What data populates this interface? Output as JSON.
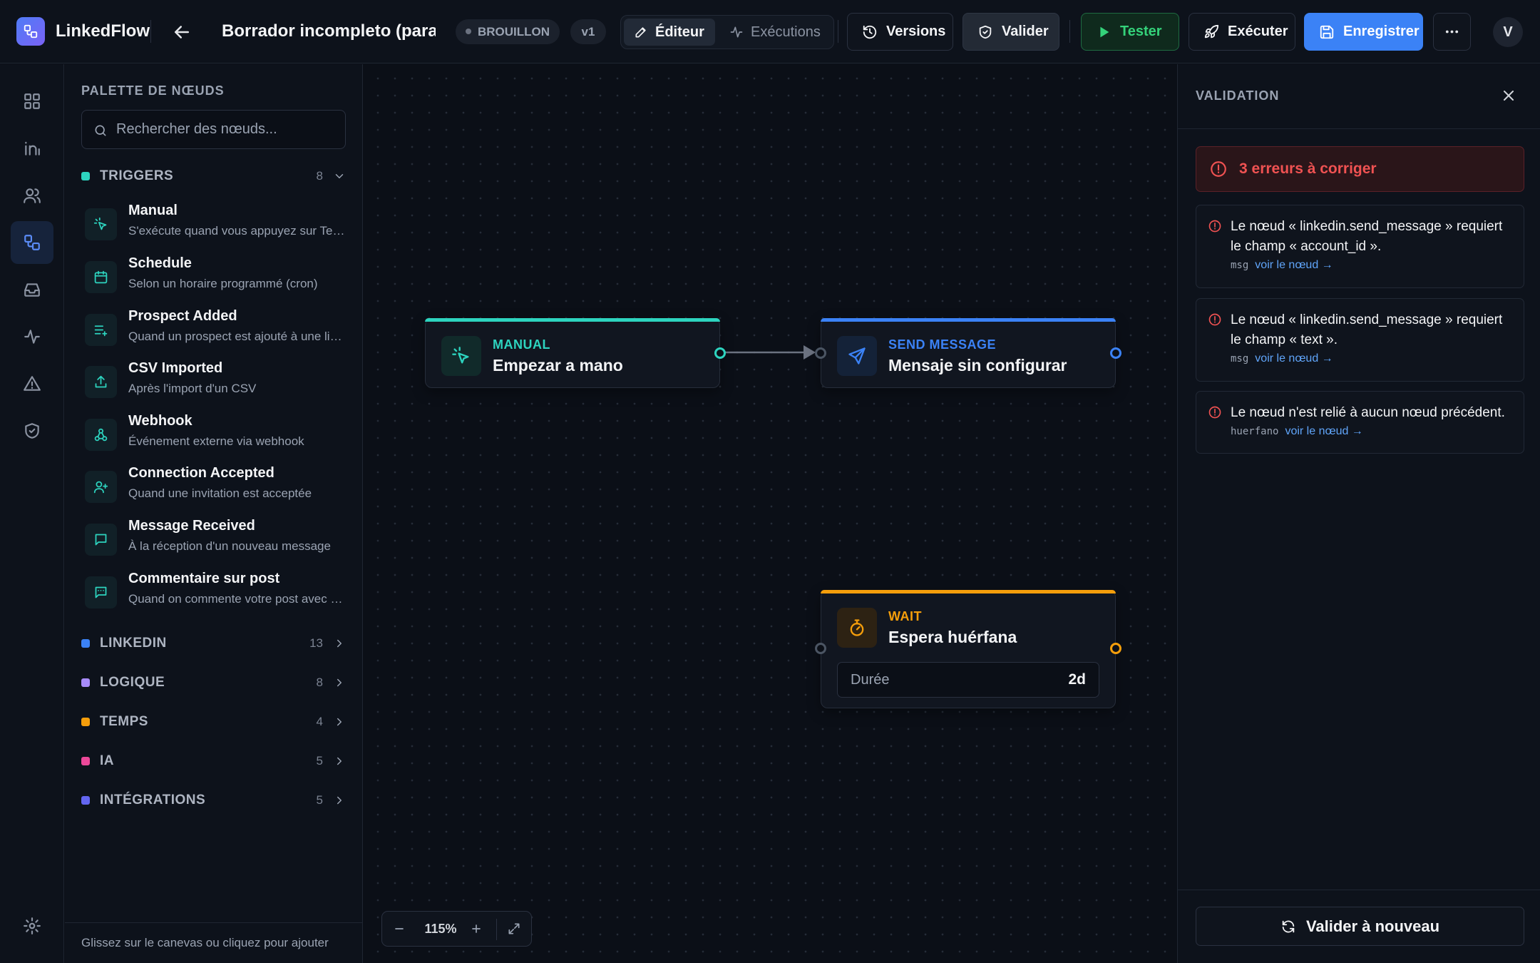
{
  "app": {
    "name": "LinkedFlow"
  },
  "header": {
    "workflow_title": "Borrador incompleto (para probar)",
    "status_badge": "BROUILLON",
    "version_badge": "v1",
    "tabs": [
      {
        "label": "Éditeur",
        "active": true
      },
      {
        "label": "Exécutions",
        "active": false
      }
    ],
    "buttons": {
      "versions": "Versions",
      "validate": "Valider",
      "test": "Tester",
      "execute": "Exécuter",
      "save": "Enregistrer"
    },
    "avatar_initial": "V"
  },
  "rail": {
    "items": [
      {
        "icon": "dashboard-icon",
        "active": false
      },
      {
        "icon": "linkedin-icon",
        "active": false
      },
      {
        "icon": "users-icon",
        "active": false
      },
      {
        "icon": "workflow-icon",
        "active": true
      },
      {
        "icon": "inbox-icon",
        "active": false
      },
      {
        "icon": "activity-icon",
        "active": false
      },
      {
        "icon": "alert-triangle-icon",
        "active": false
      },
      {
        "icon": "shield-check-icon",
        "active": false
      }
    ],
    "bottom_icon": "gear-icon"
  },
  "palette": {
    "title": "PALETTE DE NŒUDS",
    "search_placeholder": "Rechercher des nœuds...",
    "categories": [
      {
        "name": "TRIGGERS",
        "count": "8",
        "color": "#2dd4bf",
        "expanded": true
      },
      {
        "name": "LINKEDIN",
        "count": "13",
        "color": "#3b82f6",
        "expanded": false
      },
      {
        "name": "LOGIQUE",
        "count": "8",
        "color": "#a78bfa",
        "expanded": false
      },
      {
        "name": "TEMPS",
        "count": "4",
        "color": "#f59e0b",
        "expanded": false
      },
      {
        "name": "IA",
        "count": "5",
        "color": "#ec4899",
        "expanded": false
      },
      {
        "name": "INTÉGRATIONS",
        "count": "5",
        "color": "#6366f1",
        "expanded": false
      }
    ],
    "trigger_items": [
      {
        "title": "Manual",
        "desc": "S'exécute quand vous appuyez sur Tester",
        "icon": "pointer-click-icon"
      },
      {
        "title": "Schedule",
        "desc": "Selon un horaire programmé (cron)",
        "icon": "calendar-icon"
      },
      {
        "title": "Prospect Added",
        "desc": "Quand un prospect est ajouté à une liste",
        "icon": "list-plus-icon"
      },
      {
        "title": "CSV Imported",
        "desc": "Après l'import d'un CSV",
        "icon": "upload-icon"
      },
      {
        "title": "Webhook",
        "desc": "Événement externe via webhook",
        "icon": "webhook-icon"
      },
      {
        "title": "Connection Accepted",
        "desc": "Quand une invitation est acceptée",
        "icon": "user-plus-icon"
      },
      {
        "title": "Message Received",
        "desc": "À la réception d'un nouveau message",
        "icon": "message-icon"
      },
      {
        "title": "Commentaire sur post",
        "desc": "Quand on commente votre post avec un mot-clé",
        "icon": "comment-icon"
      }
    ],
    "footer_hint": "Glissez sur le canevas ou cliquez pour ajouter"
  },
  "canvas": {
    "nodes": {
      "manual": {
        "type": "MANUAL",
        "name": "Empezar a mano",
        "color": "#2dd4bf",
        "icon": "pointer-click-icon"
      },
      "send_message": {
        "type": "SEND MESSAGE",
        "name": "Mensaje sin configurar",
        "color": "#3b82f6",
        "icon": "send-icon"
      },
      "wait": {
        "type": "WAIT",
        "name": "Espera huérfana",
        "color": "#f59e0b",
        "icon": "timer-icon",
        "field_label": "Durée",
        "field_value": "2d"
      }
    },
    "zoom_label": "115%"
  },
  "validation": {
    "title": "VALIDATION",
    "summary": "3 erreurs à corriger",
    "errors": [
      {
        "message": "Le nœud « linkedin.send_message » requiert le champ « account_id ».",
        "code": "msg",
        "link": "voir le nœud →"
      },
      {
        "message": "Le nœud « linkedin.send_message » requiert le champ « text ».",
        "code": "msg",
        "link": "voir le nœud →"
      },
      {
        "message": "Le nœud n'est relié à aucun nœud précédent.",
        "code": "huerfano",
        "link": "voir le nœud →"
      }
    ],
    "revalidate_label": "Valider à nouveau"
  }
}
